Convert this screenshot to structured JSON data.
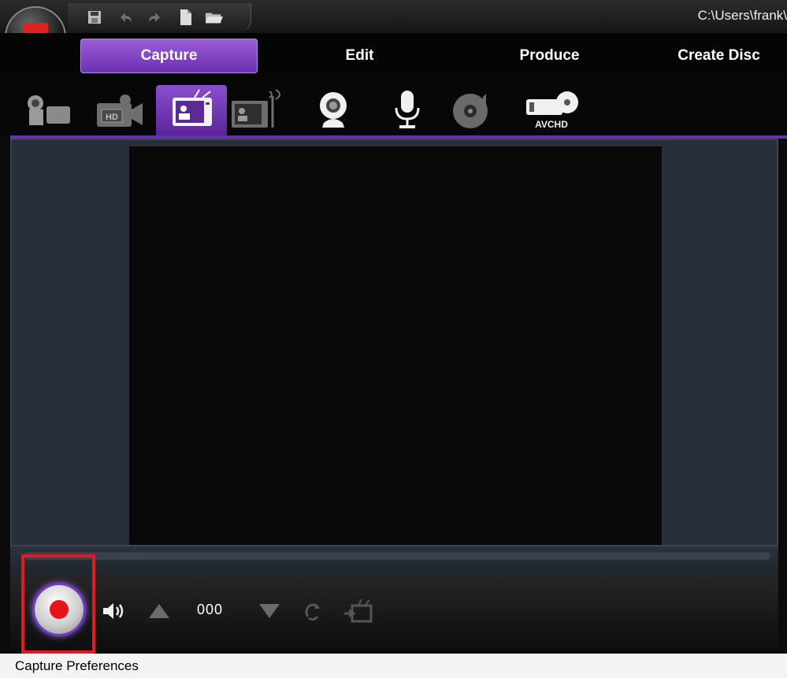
{
  "titlebar": {
    "path": "C:\\Users\\frank\\",
    "quick_access": [
      {
        "icon": "save-icon"
      },
      {
        "icon": "undo-icon"
      },
      {
        "icon": "redo-icon"
      },
      {
        "icon": "new-file-icon"
      },
      {
        "icon": "open-folder-icon"
      }
    ]
  },
  "main_tabs": [
    {
      "label": "Capture",
      "active": true
    },
    {
      "label": "Edit",
      "active": false
    },
    {
      "label": "Produce",
      "active": false
    },
    {
      "label": "Create Disc",
      "active": false
    }
  ],
  "capture_sources": [
    {
      "icon": "dv-camcorder-icon",
      "active": false
    },
    {
      "icon": "hdv-camcorder-icon",
      "active": false
    },
    {
      "icon": "tv-icon",
      "active": true
    },
    {
      "icon": "digital-tv-icon",
      "active": false
    },
    {
      "icon": "webcam-icon",
      "active": false
    },
    {
      "icon": "microphone-icon",
      "active": false
    },
    {
      "icon": "cd-audio-icon",
      "active": false
    },
    {
      "icon": "avchd-icon",
      "active": false,
      "label": "AVCHD"
    }
  ],
  "controls": {
    "counter": "000",
    "record": {
      "icon": "record-icon"
    }
  },
  "status": {
    "text": "Capture Preferences"
  },
  "colors": {
    "accent": "#7a3fc4",
    "record": "#e8141b",
    "highlight": "#e01b24"
  }
}
